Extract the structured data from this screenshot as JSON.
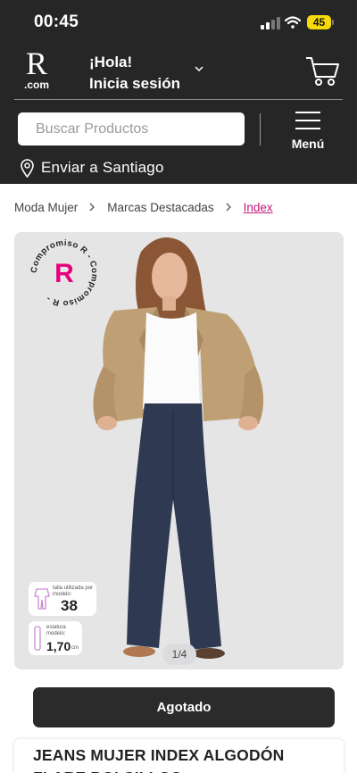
{
  "status_bar": {
    "time": "00:45",
    "battery": "45"
  },
  "header": {
    "logo_letter": "R",
    "logo_domain": ".com",
    "greeting": "¡Hola!",
    "login": "Inicia sesión",
    "search_placeholder": "Buscar Productos",
    "menu_label": "Menú",
    "location": "Enviar a Santiago"
  },
  "breadcrumb": [
    "Moda Mujer",
    "Marcas Destacadas",
    "Index"
  ],
  "product": {
    "badge_text": "Compromiso R - Compromiso R -",
    "badge_letter": "R",
    "size_label": "talla utilizada por modelo:",
    "size_value": "38",
    "height_label": "estatura modelo:",
    "height_value": "1,70",
    "height_unit": "cm",
    "image_counter": "1/4",
    "status_button": "Agotado",
    "title": "JEANS MUJER INDEX ALGODÓN FLARE BOLSILLOS"
  },
  "colors": {
    "header_bg": "#262626",
    "accent_pink": "#e6007e",
    "breadcrumb_active": "#c2187a"
  }
}
